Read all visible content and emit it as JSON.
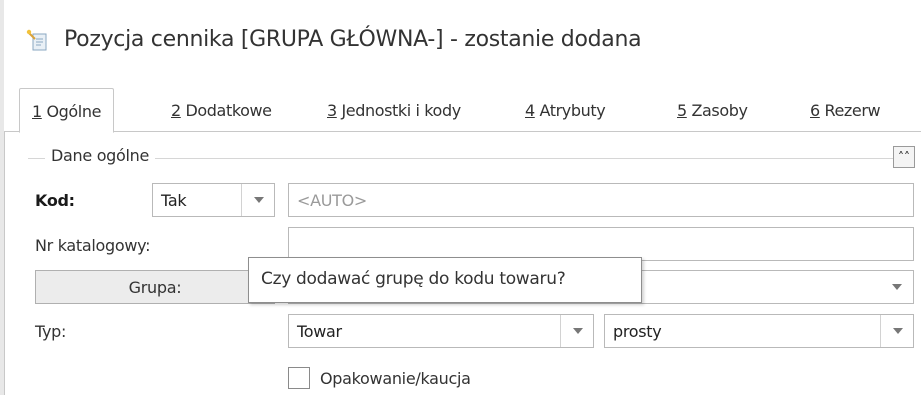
{
  "window": {
    "title": "Pozycja cennika [GRUPA GŁÓWNA-] - zostanie dodana",
    "title_icon": "document-wand-icon"
  },
  "tabs": [
    {
      "num": "1",
      "label": "Ogólne",
      "active": true
    },
    {
      "num": "2",
      "label": "Dodatkowe"
    },
    {
      "num": "3",
      "label": "Jednostki i kody"
    },
    {
      "num": "4",
      "label": "Atrybuty"
    },
    {
      "num": "5",
      "label": "Zasoby"
    },
    {
      "num": "6",
      "label": "Rezerw"
    }
  ],
  "section": {
    "title": "Dane ogólne",
    "collapse_icon": "double-chevron-up-icon",
    "collapse_glyph": "˄˄"
  },
  "form": {
    "kod_label": "Kod:",
    "kod_select_value": "Tak",
    "kod_value": "<AUTO>",
    "nr_katalogowy_label": "Nr katalogowy:",
    "nr_katalogowy_value": "",
    "grupa_button": "Grupa:",
    "grupa_value": "",
    "typ_label": "Typ:",
    "typ_value": "Towar",
    "typ_sub_value": "prosty",
    "opakowanie_label": "Opakowanie/kaucja",
    "opakowanie_checked": false
  },
  "tooltip": {
    "text": "Czy dodawać grupę do kodu towaru?"
  },
  "colors": {
    "border": "#b9b9b9",
    "tab_border": "#c8c8c8",
    "placeholder": "#9a9a9a",
    "button_bg": "#ececec"
  }
}
